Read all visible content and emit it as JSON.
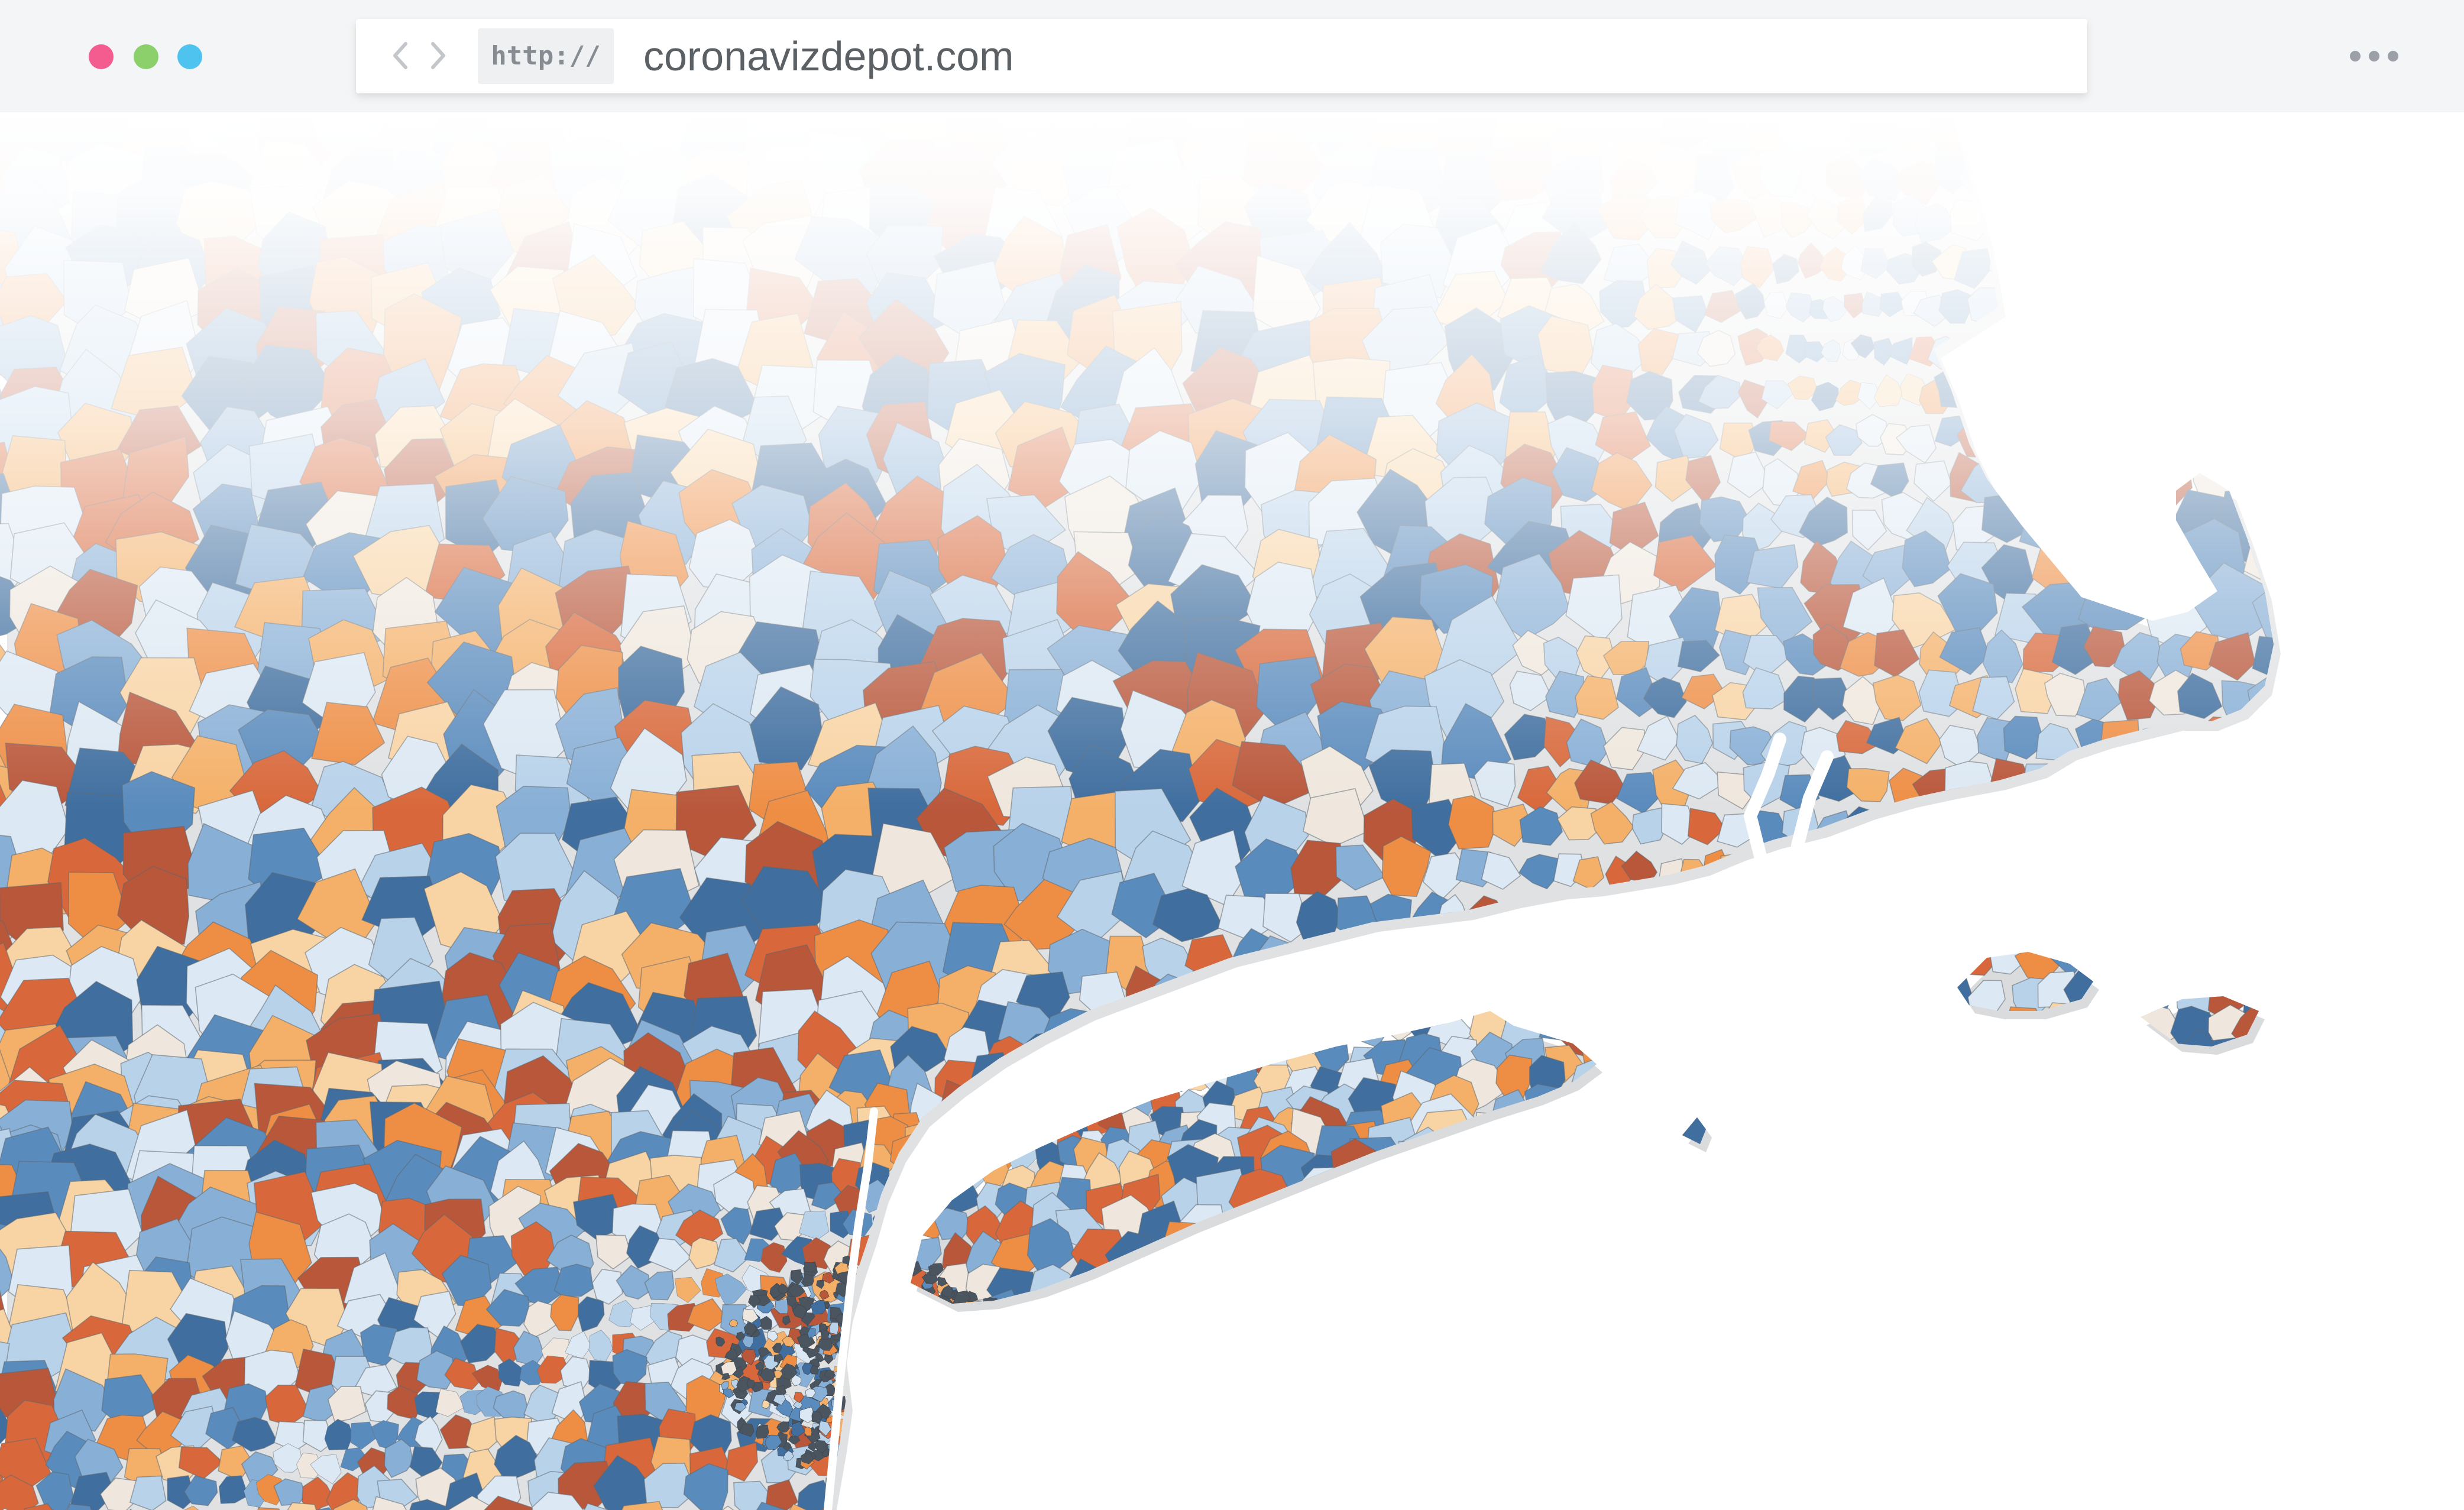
{
  "browser": {
    "traffic_lights": {
      "close_color": "#f45b8f",
      "minimize_color": "#8bd06b",
      "maximize_color": "#4fc3f0"
    },
    "nav": {
      "back_icon": "chevron-left-icon",
      "forward_icon": "chevron-right-icon"
    },
    "address": {
      "scheme": "http://",
      "url": "coronavizdepot.com"
    },
    "menu_icon": "more-horizontal-icon"
  },
  "page": {
    "visual": "choropleth-map",
    "palette": [
      "#3f6e9f",
      "#5a8bbd",
      "#88afd6",
      "#b8d2ea",
      "#dce8f3",
      "#efe7dd",
      "#f8d3a3",
      "#f4b068",
      "#ee8e45",
      "#d8683b",
      "#b9573b"
    ]
  }
}
